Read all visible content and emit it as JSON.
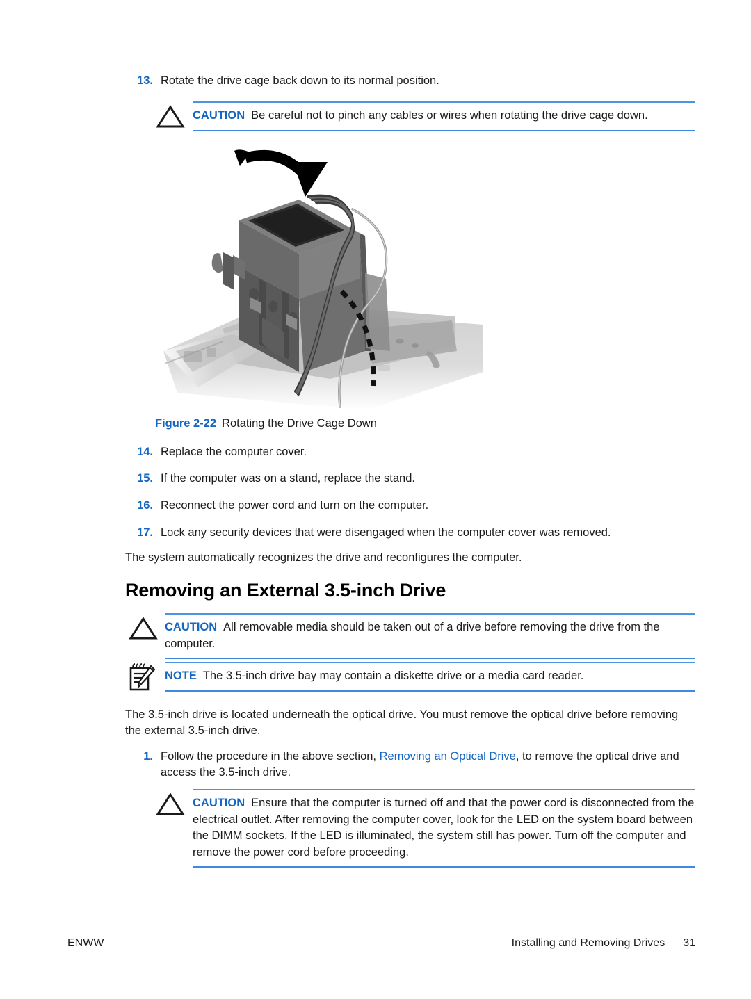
{
  "page": {
    "number": "31",
    "footer_left": "ENWW",
    "footer_right_title": "Installing and Removing Drives"
  },
  "steps_upper": [
    {
      "num": "13.",
      "text": "Rotate the drive cage back down to its normal position."
    }
  ],
  "caution_1": {
    "label": "CAUTION",
    "text": "Be careful not to pinch any cables or wires when rotating the drive cage down.",
    "icon": "caution-triangle-icon"
  },
  "figure": {
    "number": "Figure 2-22",
    "title": "Rotating the Drive Cage Down",
    "alt": "Illustration of a computer chassis with the drive cage being rotated back down, indicated by a large curved black arrow and a dashed cable-routing path."
  },
  "steps_lower": [
    {
      "num": "14.",
      "text": "Replace the computer cover."
    },
    {
      "num": "15.",
      "text": "If the computer was on a stand, replace the stand."
    },
    {
      "num": "16.",
      "text": "Reconnect the power cord and turn on the computer."
    },
    {
      "num": "17.",
      "text": "Lock any security devices that were disengaged when the computer cover was removed."
    }
  ],
  "paragraph_after_steps": "The system automatically recognizes the drive and reconfigures the computer.",
  "heading": "Removing an External 3.5-inch Drive",
  "caution_2": {
    "label": "CAUTION",
    "text": "All removable media should be taken out of a drive before removing the drive from the computer.",
    "icon": "caution-triangle-icon"
  },
  "note_1": {
    "label": "NOTE",
    "text": "The 3.5-inch drive bay may contain a diskette drive or a media card reader.",
    "icon": "note-pad-icon"
  },
  "intro_paragraph": "The 3.5-inch drive is located underneath the optical drive. You must remove the optical drive before removing the external 3.5-inch drive.",
  "step_1": {
    "num": "1.",
    "text_before": "Follow the procedure in the above section, ",
    "link_text": "Removing an Optical Drive",
    "text_after": ", to remove the optical drive and access the 3.5-inch drive."
  },
  "caution_3": {
    "label": "CAUTION",
    "text": "Ensure that the computer is turned off and that the power cord is disconnected from the electrical outlet. After removing the computer cover, look for the LED on the system board between the DIMM sockets. If the LED is illuminated, the system still has power. Turn off the computer and remove the power cord before proceeding.",
    "icon": "caution-triangle-icon"
  },
  "colors": {
    "accent_blue": "#1566c0",
    "rule_blue": "#4c93e0",
    "text": "#1a1a1a"
  }
}
